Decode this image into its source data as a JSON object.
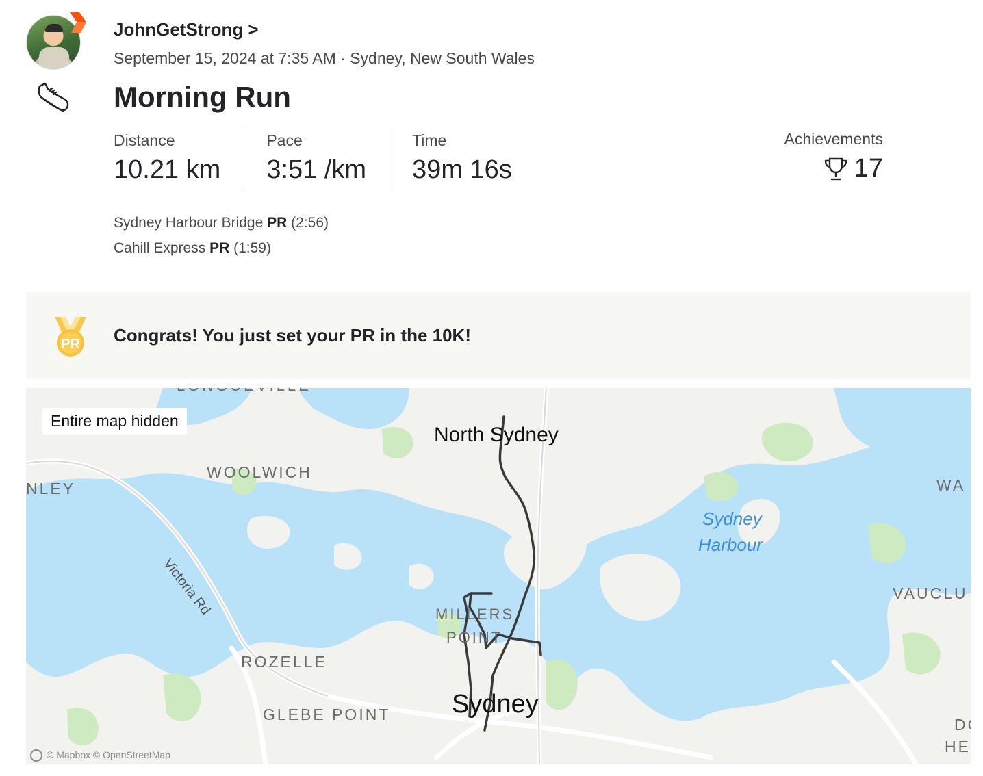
{
  "athlete": {
    "name": "JohnGetStrong >",
    "meta": "September 15, 2024 at 7:35 AM · Sydney, New South Wales"
  },
  "activity": {
    "title": "Morning Run",
    "stats": [
      {
        "label": "Distance",
        "value": "10.21 km"
      },
      {
        "label": "Pace",
        "value": "3:51 /km"
      },
      {
        "label": "Time",
        "value": "39m 16s"
      }
    ],
    "achievements": {
      "label": "Achievements",
      "value": "17"
    }
  },
  "segments": [
    {
      "name": "Sydney Harbour Bridge",
      "badge": "PR",
      "time": "(2:56)"
    },
    {
      "name": "Cahill Express",
      "badge": "PR",
      "time": "(1:59)"
    }
  ],
  "congrats": {
    "text": "Congrats! You just set your PR in the 10K!",
    "medal_label": "PR"
  },
  "map": {
    "hidden_label": "Entire map hidden",
    "attribution": "© Mapbox © OpenStreetMap",
    "labels": {
      "longueville": "LONGUEVILLE",
      "north_sydney": "North Sydney",
      "woolwich": "WOOLWICH",
      "henley": "NLEY",
      "wa": "WA",
      "sydney_harbour_1": "Sydney",
      "sydney_harbour_2": "Harbour",
      "victoria_rd": "Victoria Rd",
      "millers_1": "MILLERS",
      "millers_2": "POINT",
      "vaucluse": "VAUCLU",
      "rozelle": "ROZELLE",
      "sydney": "Sydney",
      "glebe_point": "GLEBE POINT",
      "do": "DO",
      "hei": "HEI"
    },
    "colors": {
      "water": "#b9e2f8",
      "land": "#f2f2ef",
      "park": "#cdeac0",
      "road": "#ffffff",
      "route": "#3a3a3a",
      "harbour_label": "#3b8fd6"
    }
  }
}
